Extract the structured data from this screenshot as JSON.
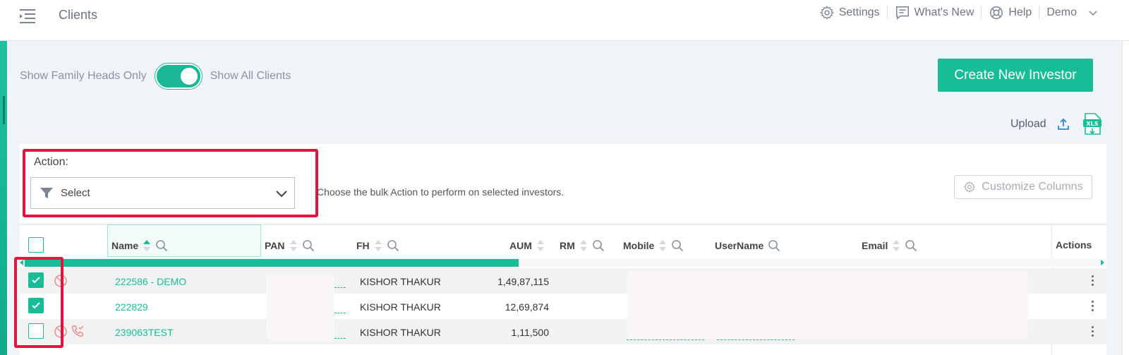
{
  "header": {
    "title": "Clients",
    "nav": [
      {
        "label": "Settings",
        "icon": "gear-icon"
      },
      {
        "label": "What's New",
        "icon": "chat-icon"
      },
      {
        "label": "Help",
        "icon": "lifebuoy-icon"
      },
      {
        "label": "Demo",
        "icon": "chevron-down-icon"
      }
    ]
  },
  "toggle": {
    "left_label": "Show Family Heads Only",
    "right_label": "Show All Clients",
    "state": "on"
  },
  "create_button": "Create New Investor",
  "upload_label": "Upload",
  "action": {
    "label": "Action:",
    "select_value": "Select",
    "hint": "Choose the bulk Action to perform on selected investors."
  },
  "customize_button": "Customize Columns",
  "table": {
    "columns": [
      "Name",
      "PAN",
      "FH",
      "AUM",
      "RM",
      "Mobile",
      "UserName",
      "Email",
      "Actions"
    ],
    "rows": [
      {
        "checked": true,
        "name": "222586 - DEMO",
        "fh": "KISHOR THAKUR",
        "aum": "1,49,87,115"
      },
      {
        "checked": true,
        "name": "222829",
        "fh": "KISHOR THAKUR",
        "aum": "12,69,874"
      },
      {
        "checked": false,
        "name": "239063TEST",
        "fh": "KISHOR THAKUR",
        "aum": "1,11,500"
      }
    ]
  },
  "colors": {
    "accent": "#17bd97",
    "highlight": "#e0143c",
    "muted_text": "#8a93a3"
  }
}
